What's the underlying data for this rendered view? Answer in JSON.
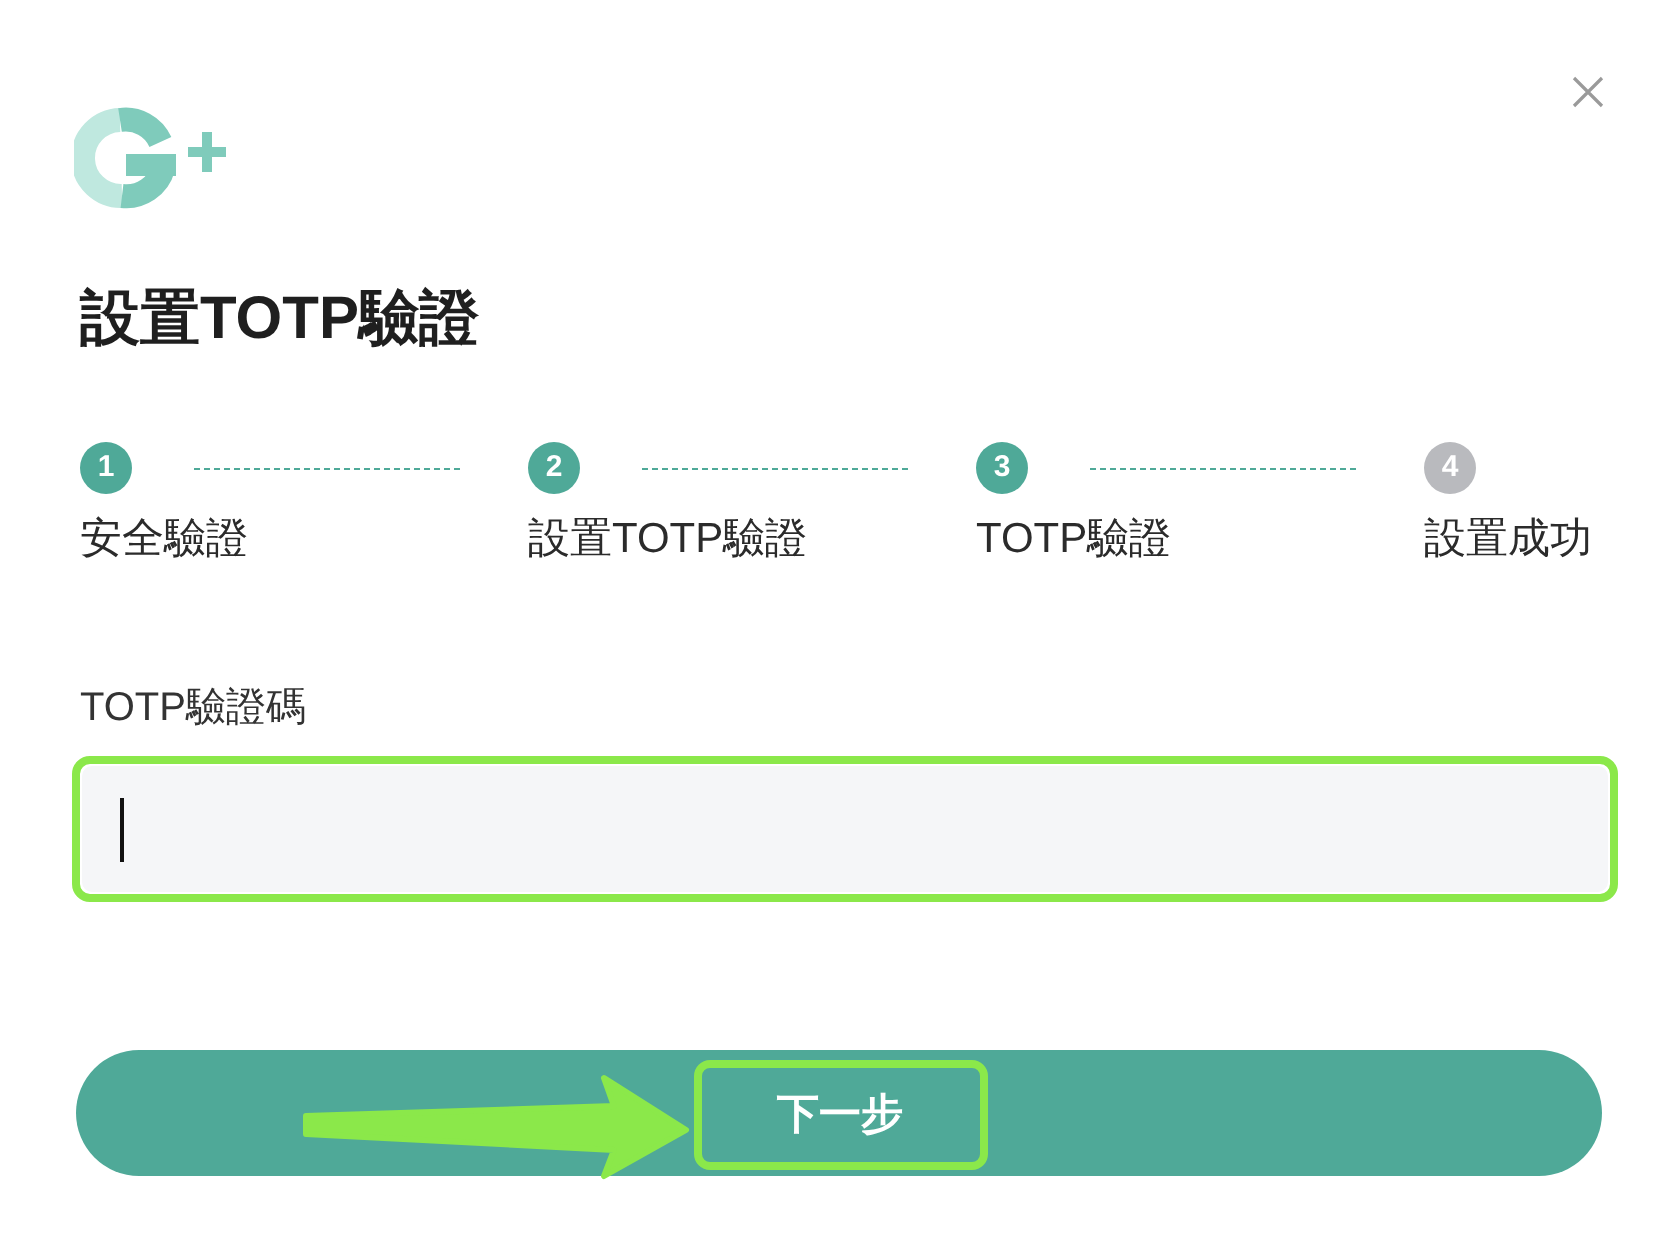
{
  "title": "設置TOTP驗證",
  "steps": [
    {
      "number": "1",
      "label": "安全驗證",
      "reached": true
    },
    {
      "number": "2",
      "label": "設置TOTP驗證",
      "reached": true
    },
    {
      "number": "3",
      "label": "TOTP驗證",
      "reached": true
    },
    {
      "number": "4",
      "label": "設置成功",
      "reached": false
    }
  ],
  "code_field": {
    "label": "TOTP驗證碼",
    "focused": true,
    "highlighted": true
  },
  "next_button": {
    "label": "下一步",
    "highlighted": true,
    "arrow": true
  }
}
